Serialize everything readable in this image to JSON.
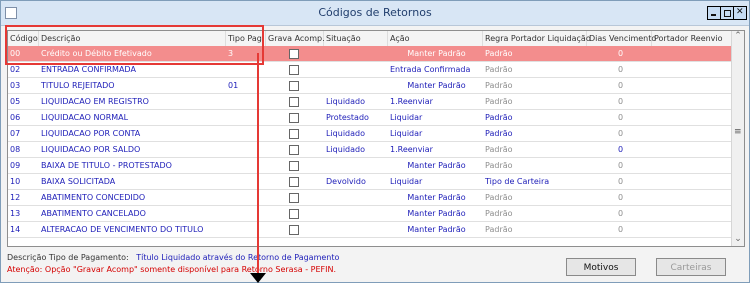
{
  "window": {
    "title": "Códigos de Retornos"
  },
  "table": {
    "headers": [
      "Código",
      "Descrição",
      "Tipo Pag.",
      "Grava Acomp.",
      "Situação",
      "Ação",
      "Regra Portador Liquidação",
      "Dias Vencimento",
      "Portador Reenvio"
    ],
    "rows": [
      {
        "codigo": "00",
        "descricao": "Crédito ou Débito Efetivado",
        "tipo_pag": "3",
        "situacao": "",
        "acao": "Manter Padrão",
        "regra": "Padrão",
        "dias": "0",
        "portador": "",
        "selected": true
      },
      {
        "codigo": "02",
        "descricao": "ENTRADA CONFIRMADA",
        "tipo_pag": "",
        "situacao": "",
        "acao": "Entrada Confirmada",
        "regra": "Padrão",
        "dias": "0",
        "portador": ""
      },
      {
        "codigo": "03",
        "descricao": "TITULO REJEITADO",
        "tipo_pag": "01",
        "situacao": "",
        "acao": "Manter Padrão",
        "regra": "Padrão",
        "dias": "0",
        "portador": ""
      },
      {
        "codigo": "05",
        "descricao": "LIQUIDACAO EM REGISTRO",
        "tipo_pag": "",
        "situacao": "Liquidado",
        "acao": "1.Reenviar",
        "regra": "Padrão",
        "dias": "0",
        "portador": ""
      },
      {
        "codigo": "06",
        "descricao": "LIQUIDACAO NORMAL",
        "tipo_pag": "",
        "situacao": "Protestado",
        "acao": "Liquidar",
        "regra": "Padrão",
        "dias": "0",
        "portador": ""
      },
      {
        "codigo": "07",
        "descricao": "LIQUIDACAO POR CONTA",
        "tipo_pag": "",
        "situacao": "Liquidado",
        "acao": "Liquidar",
        "regra": "Padrão",
        "dias": "0",
        "portador": ""
      },
      {
        "codigo": "08",
        "descricao": "LIQUIDACAO POR SALDO",
        "tipo_pag": "",
        "situacao": "Liquidado",
        "acao": "1.Reenviar",
        "regra": "Padrão",
        "dias": "0",
        "portador": ""
      },
      {
        "codigo": "09",
        "descricao": "BAIXA DE TITULO - PROTESTADO",
        "tipo_pag": "",
        "situacao": "",
        "acao": "Manter Padrão",
        "regra": "Padrão",
        "dias": "0",
        "portador": ""
      },
      {
        "codigo": "10",
        "descricao": "BAIXA SOLICITADA",
        "tipo_pag": "",
        "situacao": "Devolvido",
        "acao": "Liquidar",
        "regra": "Tipo de Carteira",
        "dias": "0",
        "portador": ""
      },
      {
        "codigo": "12",
        "descricao": "ABATIMENTO CONCEDIDO",
        "tipo_pag": "",
        "situacao": "",
        "acao": "Manter Padrão",
        "regra": "Padrão",
        "dias": "0",
        "portador": ""
      },
      {
        "codigo": "13",
        "descricao": "ABATIMENTO CANCELADO",
        "tipo_pag": "",
        "situacao": "",
        "acao": "Manter Padrão",
        "regra": "Padrão",
        "dias": "0",
        "portador": ""
      },
      {
        "codigo": "14",
        "descricao": "ALTERACAO DE VENCIMENTO DO TITULO",
        "tipo_pag": "",
        "situacao": "",
        "acao": "Manter Padrão",
        "regra": "Padrão",
        "dias": "0",
        "portador": ""
      }
    ]
  },
  "footer": {
    "descricao_label": "Descrição Tipo de Pagamento:",
    "descricao_value": "Título Liquidado através do Retorno de Pagamento",
    "atencao": "Atenção: Opção \"Gravar Acomp\" somente disponível para Retorno Serasa - PEFIN."
  },
  "buttons": {
    "motivos": "Motivos",
    "carteiras": "Carteiras"
  }
}
